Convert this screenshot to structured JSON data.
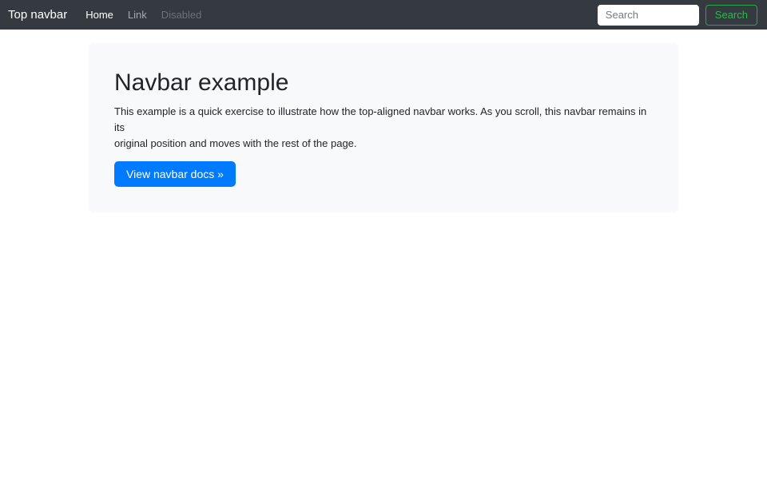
{
  "navbar": {
    "brand": "Top navbar",
    "links": [
      {
        "label": "Home",
        "state": "active"
      },
      {
        "label": "Link",
        "state": "normal"
      },
      {
        "label": "Disabled",
        "state": "disabled"
      }
    ],
    "search": {
      "placeholder": "Search",
      "button_label": "Search"
    }
  },
  "jumbotron": {
    "title": "Navbar example",
    "body": "This example is a quick exercise to illustrate how the top-aligned navbar works. As you scroll, this navbar remains in its\noriginal position and moves with the rest of the page.",
    "cta_label": "View navbar docs »"
  },
  "colors": {
    "navbar_bg": "#343a40",
    "primary": "#007bff",
    "success": "#28a745",
    "jumbotron_bg": "#f8f9fa",
    "text": "#212529"
  }
}
